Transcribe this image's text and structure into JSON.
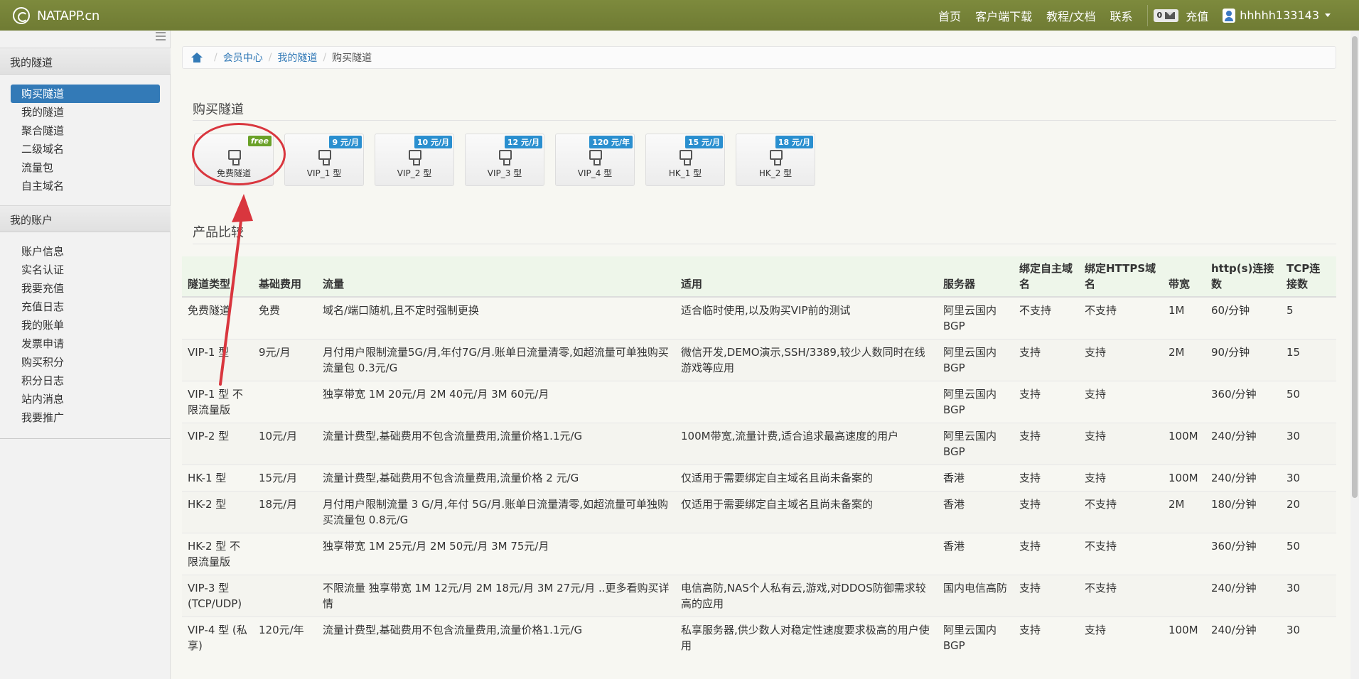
{
  "brand": {
    "name": "NATAPP.cn"
  },
  "nav": {
    "home": "首页",
    "download": "客户端下载",
    "docs": "教程/文档",
    "contact": "联系",
    "mail_count": "0",
    "recharge": "充值",
    "username": "hhhhh133143"
  },
  "sidebar": {
    "group1_title": "我的隧道",
    "group1_items": [
      "购买隧道",
      "我的隧道",
      "聚合隧道",
      "二级域名",
      "流量包",
      "自主域名"
    ],
    "group2_title": "我的账户",
    "group2_items": [
      "账户信息",
      "实名认证",
      "我要充值",
      "充值日志",
      "我的账单",
      "发票申请",
      "购买积分",
      "积分日志",
      "站内消息",
      "我要推广"
    ]
  },
  "breadcrumb": {
    "items": [
      "会员中心",
      "我的隧道"
    ],
    "current": "购买隧道"
  },
  "main": {
    "buy_title": "购买隧道",
    "compare_title": "产品比较",
    "products": [
      {
        "label": "免费隧道",
        "price": "free"
      },
      {
        "label": "VIP_1 型",
        "price": "9 元/月"
      },
      {
        "label": "VIP_2 型",
        "price": "10 元/月"
      },
      {
        "label": "VIP_3 型",
        "price": "12 元/月"
      },
      {
        "label": "VIP_4 型",
        "price": "120 元/年"
      },
      {
        "label": "HK_1 型",
        "price": "15 元/月"
      },
      {
        "label": "HK_2 型",
        "price": "18 元/月"
      }
    ]
  },
  "table": {
    "headers": [
      "隧道类型",
      "基础费用",
      "流量",
      "适用",
      "服务器",
      "绑定自主域名",
      "绑定HTTPS域名",
      "带宽",
      "http(s)连接数",
      "TCP连接数"
    ],
    "rows": [
      [
        "免费隧道",
        "免费",
        "域名/端口随机,且不定时强制更换",
        "适合临时使用,以及购买VIP前的测试",
        "阿里云国内BGP",
        "不支持",
        "不支持",
        "1M",
        "60/分钟",
        "5"
      ],
      [
        "VIP-1 型",
        "9元/月",
        "月付用户限制流量5G/月,年付7G/月.账单日流量清零,如超流量可单独购买流量包 0.3元/G",
        "微信开发,DEMO演示,SSH/3389,较少人数同时在线游戏等应用",
        "阿里云国内BGP",
        "支持",
        "支持",
        "2M",
        "90/分钟",
        "15"
      ],
      [
        "VIP-1 型 不限流量版",
        "",
        "独享带宽 1M 20元/月 2M 40元/月 3M 60元/月",
        "",
        "阿里云国内BGP",
        "支持",
        "支持",
        "",
        "360/分钟",
        "50"
      ],
      [
        "VIP-2 型",
        "10元/月",
        "流量计费型,基础费用不包含流量费用,流量价格1.1元/G",
        "100M带宽,流量计费,适合追求最高速度的用户",
        "阿里云国内BGP",
        "支持",
        "支持",
        "100M",
        "240/分钟",
        "30"
      ],
      [
        "HK-1 型",
        "15元/月",
        "流量计费型,基础费用不包含流量费用,流量价格 2 元/G",
        "仅适用于需要绑定自主域名且尚未备案的",
        "香港",
        "支持",
        "支持",
        "100M",
        "240/分钟",
        "30"
      ],
      [
        "HK-2 型",
        "18元/月",
        "月付用户限制流量 3 G/月,年付 5G/月.账单日流量清零,如超流量可单独购买流量包 0.8元/G",
        "仅适用于需要绑定自主域名且尚未备案的",
        "香港",
        "支持",
        "不支持",
        "2M",
        "180/分钟",
        "20"
      ],
      [
        "HK-2 型 不限流量版",
        "",
        "独享带宽 1M 25元/月 2M 50元/月 3M 75元/月",
        "",
        "香港",
        "支持",
        "不支持",
        "",
        "360/分钟",
        "50"
      ],
      [
        "VIP-3 型 (TCP/UDP)",
        "",
        "不限流量 独享带宽 1M 12元/月 2M 18元/月 3M 27元/月 ..更多看购买详情",
        "电信高防,NAS个人私有云,游戏,对DDOS防御需求较高的应用",
        "国内电信高防",
        "支持",
        "不支持",
        "",
        "240/分钟",
        "30"
      ],
      [
        "VIP-4 型 (私享)",
        "120元/年",
        "流量计费型,基础费用不包含流量费用,流量价格1.1元/G",
        "私享服务器,供少数人对稳定性速度要求极高的用户使用",
        "阿里云国内BGP",
        "支持",
        "支持",
        "100M",
        "240/分钟",
        "30"
      ]
    ]
  },
  "colors": {
    "navbar": "#74813a",
    "active": "#337ab7",
    "annotation": "#d9363e",
    "price_badge": "#2a8fcf",
    "free_badge": "#6aa128"
  }
}
